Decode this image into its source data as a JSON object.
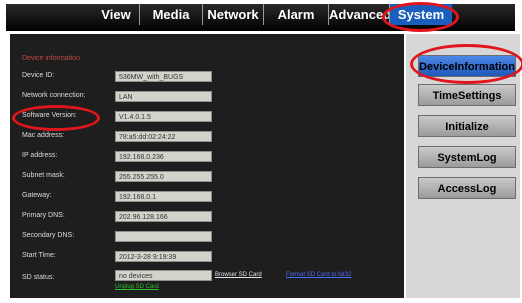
{
  "nav": {
    "tabs": [
      {
        "label": "View"
      },
      {
        "label": "Media"
      },
      {
        "label": "Network"
      },
      {
        "label": "Alarm"
      },
      {
        "label": "Advanced"
      },
      {
        "label": "System",
        "active": true
      }
    ]
  },
  "main": {
    "section_title": "Device information",
    "rows": [
      {
        "label": "Device ID:",
        "value": "536MW_with_BUGS"
      },
      {
        "label": "Network connection:",
        "value": "LAN"
      },
      {
        "label": "Software Version:",
        "value": "V1.4.0.1.5"
      },
      {
        "label": "Mac address:",
        "value": "78:a5:dd:02:24:22"
      },
      {
        "label": "IP address:",
        "value": "192.168.0.236"
      },
      {
        "label": "Subnet mask:",
        "value": "255.255.255.0"
      },
      {
        "label": "Gateway:",
        "value": "192.168.0.1"
      },
      {
        "label": "Primary DNS:",
        "value": "202.96.128.166"
      },
      {
        "label": "Secondary DNS:",
        "value": ""
      },
      {
        "label": "Start Time:",
        "value": "2012-3-28 9:19:39"
      },
      {
        "label": "SD status:",
        "value": "no devices"
      }
    ],
    "sd_links": {
      "browser": "Browser SD Card",
      "format": "Format SD Card to fat32",
      "unplug": "Unplug SD Card"
    }
  },
  "sidebar": {
    "items": [
      {
        "label": "DeviceInformation",
        "active": true
      },
      {
        "label": "TimeSettings"
      },
      {
        "label": "Initialize"
      },
      {
        "label": "SystemLog"
      },
      {
        "label": "AccessLog"
      }
    ]
  },
  "colors": {
    "accent": "#1a5fbd",
    "highlight_ring": "#e0161c"
  }
}
